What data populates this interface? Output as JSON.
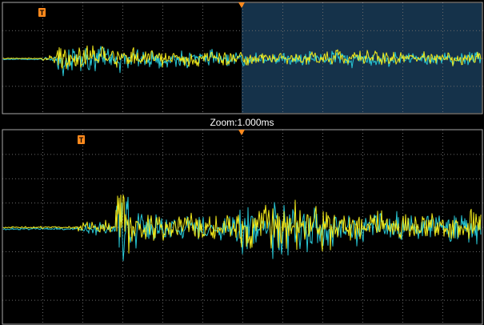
{
  "zoom": {
    "label": "Zoom:1.000ms"
  },
  "markers": {
    "trigger_text": "T"
  },
  "colors": {
    "channel_1": "#f2ea1b",
    "channel_2": "#27c6d4",
    "zoom_window": "#15324a",
    "grid": "#6a6a6a",
    "frame": "#a8a8a8",
    "trigger_marker": "#ff8a1d",
    "label_text": "#ffffff"
  }
}
